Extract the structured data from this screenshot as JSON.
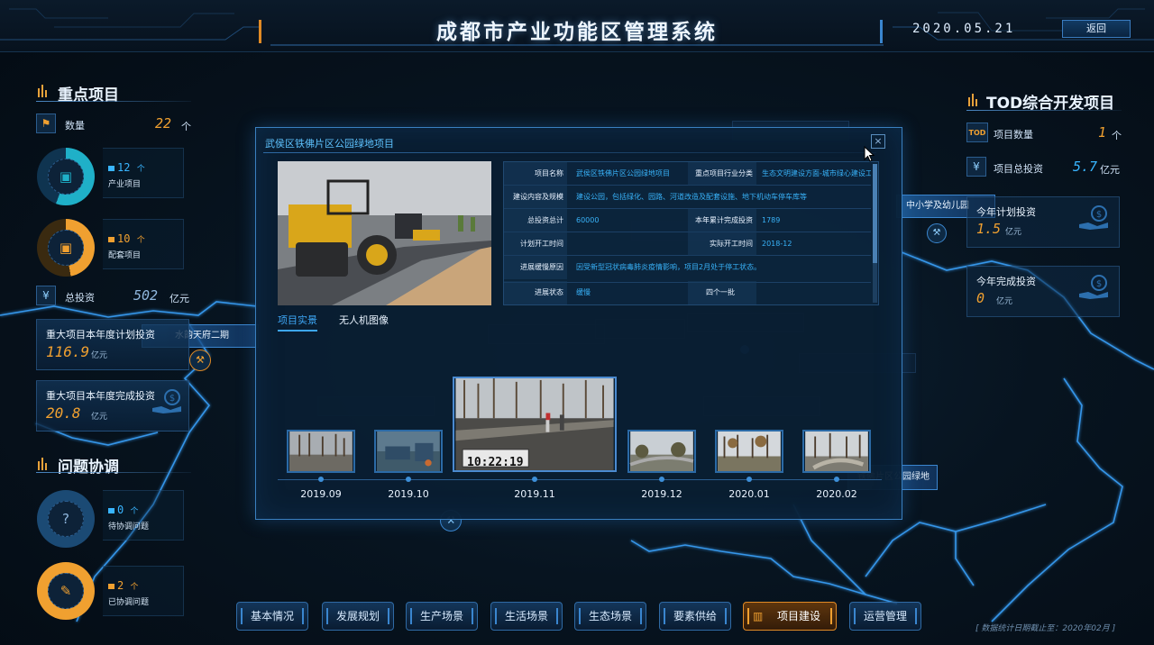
{
  "header": {
    "title": "成都市产业功能区管理系统",
    "date": "2020.05.21",
    "back_label": "返回"
  },
  "left": {
    "key_projects": {
      "title": "重点项目",
      "count_label": "数量",
      "count_value": "22",
      "count_unit": "个",
      "industry": {
        "value": "12",
        "unit": "个",
        "label": "产业项目"
      },
      "support": {
        "value": "10",
        "unit": "个",
        "label": "配套项目"
      },
      "invest_label": "总投资",
      "invest_value": "502",
      "invest_unit": "亿元",
      "plan_card": {
        "title": "重大项目本年度计划投资",
        "value": "116.9",
        "unit": "亿元"
      },
      "done_card": {
        "title": "重大项目本年度完成投资",
        "value": "20.8",
        "unit": "亿元"
      }
    },
    "issues": {
      "title": "问题协调",
      "pending": {
        "value": "0",
        "unit": "个",
        "label": "待协调问题"
      },
      "resolved": {
        "value": "2",
        "unit": "个",
        "label": "已协调问题"
      }
    }
  },
  "right": {
    "tod": {
      "title": "TOD综合开发项目",
      "badge": "TOD",
      "count_label": "项目数量",
      "count_value": "1",
      "count_unit": "个",
      "invest_label": "项目总投资",
      "invest_value": "5.7",
      "invest_unit": "亿元",
      "plan_card": {
        "title": "今年计划投资",
        "value": "1.5",
        "unit": "亿元"
      },
      "done_card": {
        "title": "今年完成投资",
        "value": "0",
        "unit": "亿元"
      }
    }
  },
  "map": {
    "labels": {
      "shuiyun": "水韵天府二期",
      "school": "中小学及幼儿园",
      "greenland": "铁佛片区公园绿地"
    }
  },
  "modal": {
    "title": "武侯区铁佛片区公园绿地项目",
    "close_label": "×",
    "rows": [
      {
        "l1": "项目名称",
        "v1": "武侯区铁佛片区公园绿地项目",
        "l2": "重点项目行业分类",
        "v2": "生态文明建设方面-城市绿心建设工"
      },
      {
        "l1": "建设内容及规模",
        "v1": "建设公园，包括绿化、园路、河道改造及配套设施、地下机动车停车库等",
        "l2": "",
        "v2": ""
      },
      {
        "l1": "总投资总计",
        "v1": "60000",
        "l2": "本年累计完成投资",
        "v2": "1789"
      },
      {
        "l1": "计划开工时间",
        "v1": "",
        "l2": "实际开工时间",
        "v2": "2018-12"
      },
      {
        "l1": "进展缓慢原因",
        "v1": "因受新型冠状病毒肺炎疫情影响，项目2月处于停工状态。",
        "l2": "",
        "v2": ""
      },
      {
        "l1": "进展状态",
        "v1": "缓慢",
        "l2": "四个一批",
        "v2": ""
      }
    ],
    "tabs": [
      {
        "label": "项目实景",
        "active": true
      },
      {
        "label": "无人机图像",
        "active": false
      }
    ],
    "timeline": [
      "2019.09",
      "2019.10",
      "2019.11",
      "2019.12",
      "2020.01",
      "2020.02"
    ],
    "photo_timestamp": "10:22:19",
    "photo_date": "2019-11"
  },
  "nav": {
    "items": [
      "基本情况",
      "发展规划",
      "生产场景",
      "生活场景",
      "生态场景",
      "要素供给",
      "项目建设",
      "运营管理"
    ],
    "active": "项目建设"
  },
  "footnote": "[ 数据统计日期截止至：2020年02月 ]",
  "colors": {
    "accent_blue": "#39b5ff",
    "accent_orange": "#f0a030",
    "panel_border": "#3a80c0"
  }
}
